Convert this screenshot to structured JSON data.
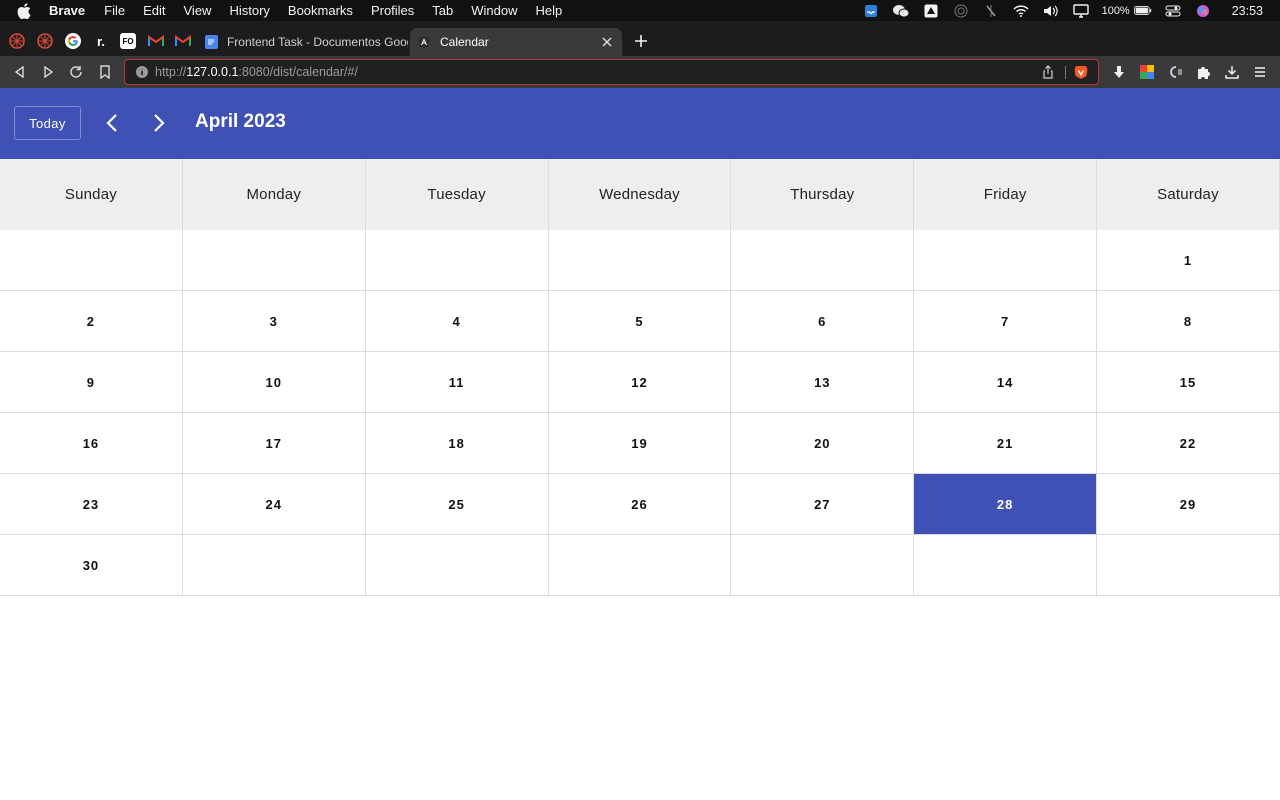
{
  "menubar": {
    "app_name": "Brave",
    "items": [
      "File",
      "Edit",
      "View",
      "History",
      "Bookmarks",
      "Profiles",
      "Tab",
      "Window",
      "Help"
    ],
    "battery": "100%",
    "clock": "23:53"
  },
  "tabs": {
    "inactive_title": "Frontend Task - Documentos Google",
    "active_title": "Calendar"
  },
  "toolbar": {
    "url_scheme": "http://",
    "url_host": "127.0.0.1",
    "url_rest": ":8080/dist/calendar/#/"
  },
  "calendar": {
    "today_label": "Today",
    "month_title": "April 2023",
    "weekdays": [
      "Sunday",
      "Monday",
      "Tuesday",
      "Wednesday",
      "Thursday",
      "Friday",
      "Saturday"
    ],
    "weeks": [
      [
        "",
        "",
        "",
        "",
        "",
        "",
        "1"
      ],
      [
        "2",
        "3",
        "4",
        "5",
        "6",
        "7",
        "8"
      ],
      [
        "9",
        "10",
        "11",
        "12",
        "13",
        "14",
        "15"
      ],
      [
        "16",
        "17",
        "18",
        "19",
        "20",
        "21",
        "22"
      ],
      [
        "23",
        "24",
        "25",
        "26",
        "27",
        "28",
        "29"
      ],
      [
        "30",
        "",
        "",
        "",
        "",
        "",
        ""
      ]
    ],
    "selected_day": "28",
    "accent_color": "#3f51b5"
  }
}
